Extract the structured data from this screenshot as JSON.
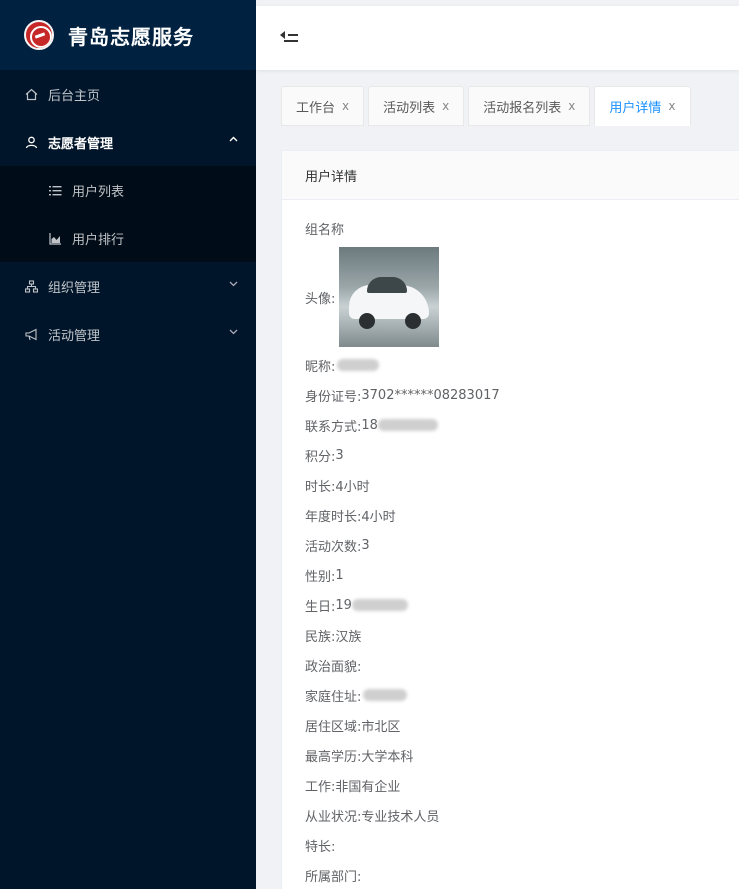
{
  "app": {
    "title": "青岛志愿服务"
  },
  "sidebar": {
    "items": [
      {
        "label": "后台主页",
        "icon": "home-icon"
      },
      {
        "label": "志愿者管理",
        "icon": "user-icon",
        "expanded": true,
        "children": [
          {
            "label": "用户列表",
            "icon": "list-icon"
          },
          {
            "label": "用户排行",
            "icon": "area-chart-icon"
          }
        ]
      },
      {
        "label": "组织管理",
        "icon": "cluster-icon"
      },
      {
        "label": "活动管理",
        "icon": "notification-icon"
      }
    ]
  },
  "tabs": [
    {
      "label": "工作台",
      "close": "x"
    },
    {
      "label": "活动列表",
      "close": "x"
    },
    {
      "label": "活动报名列表",
      "close": "x"
    },
    {
      "label": "用户详情",
      "close": "x",
      "active": true
    }
  ],
  "card": {
    "title": "用户详情",
    "group_label": "组名称",
    "avatar_label": "头像:",
    "fields": [
      {
        "label": "昵称:",
        "value": ""
      },
      {
        "label": "身份证号:",
        "value": "3702******08283017"
      },
      {
        "label": "联系方式:",
        "value": "18"
      },
      {
        "label": "积分:",
        "value": "3"
      },
      {
        "label": "时长:",
        "value": "4小时"
      },
      {
        "label": "年度时长:",
        "value": "4小时"
      },
      {
        "label": "活动次数:",
        "value": "3"
      },
      {
        "label": "性别:",
        "value": "1"
      },
      {
        "label": "生日:",
        "value": "19"
      },
      {
        "label": "民族:",
        "value": "汉族"
      },
      {
        "label": "政治面貌:",
        "value": ""
      },
      {
        "label": "家庭住址:",
        "value": ""
      },
      {
        "label": "居住区域:",
        "value": "市北区"
      },
      {
        "label": "最高学历:",
        "value": "大学本科"
      },
      {
        "label": "工作:",
        "value": "非国有企业"
      },
      {
        "label": "从业状况:",
        "value": "专业技术人员"
      },
      {
        "label": "特长:",
        "value": ""
      },
      {
        "label": "所属部门:",
        "value": ""
      }
    ]
  },
  "colors": {
    "sidebar": "#001529",
    "accent": "#1890ff"
  }
}
